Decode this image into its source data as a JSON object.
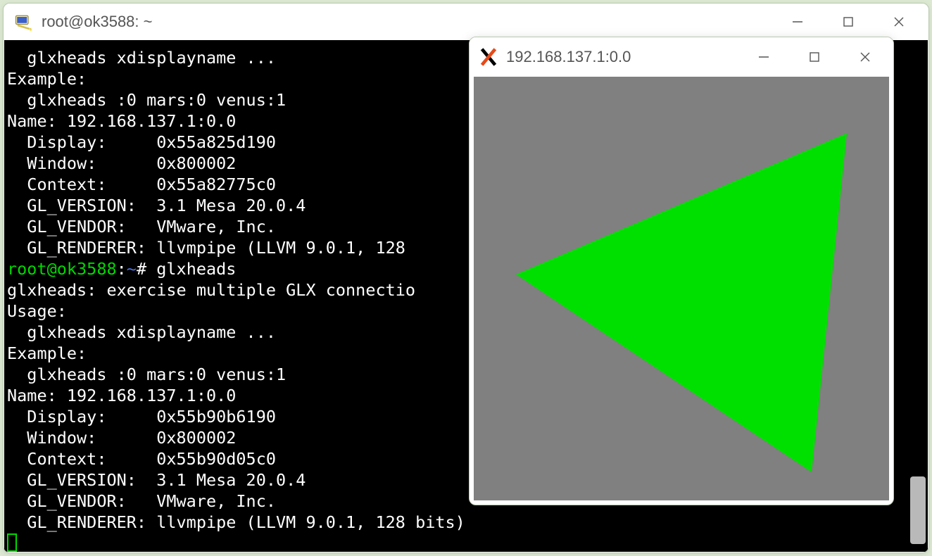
{
  "main_window": {
    "title": "root@ok3588: ~",
    "controls": {
      "minimize": "minimize",
      "maximize": "maximize",
      "close": "close"
    }
  },
  "x_window": {
    "title": "192.168.137.1:0.0",
    "controls": {
      "minimize": "minimize",
      "maximize": "maximize",
      "close": "close"
    },
    "render": {
      "background": "#808080",
      "triangle_color": "#00e000"
    }
  },
  "terminal": {
    "lines": [
      {
        "segs": [
          {
            "cls": "white",
            "t": "  glxheads xdisplayname ..."
          }
        ]
      },
      {
        "segs": [
          {
            "cls": "white",
            "t": "Example:"
          }
        ]
      },
      {
        "segs": [
          {
            "cls": "white",
            "t": "  glxheads :0 mars:0 venus:1"
          }
        ]
      },
      {
        "segs": [
          {
            "cls": "white",
            "t": "Name: 192.168.137.1:0.0"
          }
        ]
      },
      {
        "segs": [
          {
            "cls": "white",
            "t": "  Display:     0x55a825d190"
          }
        ]
      },
      {
        "segs": [
          {
            "cls": "white",
            "t": "  Window:      0x800002"
          }
        ]
      },
      {
        "segs": [
          {
            "cls": "white",
            "t": "  Context:     0x55a82775c0"
          }
        ]
      },
      {
        "segs": [
          {
            "cls": "white",
            "t": "  GL_VERSION:  3.1 Mesa 20.0.4"
          }
        ]
      },
      {
        "segs": [
          {
            "cls": "white",
            "t": "  GL_VENDOR:   VMware, Inc."
          }
        ]
      },
      {
        "segs": [
          {
            "cls": "white",
            "t": "  GL_RENDERER: llvmpipe (LLVM 9.0.1, 128 "
          }
        ]
      },
      {
        "segs": [
          {
            "cls": "green",
            "t": "root@ok3588"
          },
          {
            "cls": "white",
            "t": ":"
          },
          {
            "cls": "blue",
            "t": "~"
          },
          {
            "cls": "white",
            "t": "# glxheads"
          }
        ]
      },
      {
        "segs": [
          {
            "cls": "white",
            "t": "glxheads: exercise multiple GLX connectio"
          }
        ]
      },
      {
        "segs": [
          {
            "cls": "white",
            "t": "Usage:"
          }
        ]
      },
      {
        "segs": [
          {
            "cls": "white",
            "t": "  glxheads xdisplayname ..."
          }
        ]
      },
      {
        "segs": [
          {
            "cls": "white",
            "t": "Example:"
          }
        ]
      },
      {
        "segs": [
          {
            "cls": "white",
            "t": "  glxheads :0 mars:0 venus:1"
          }
        ]
      },
      {
        "segs": [
          {
            "cls": "white",
            "t": "Name: 192.168.137.1:0.0"
          }
        ]
      },
      {
        "segs": [
          {
            "cls": "white",
            "t": "  Display:     0x55b90b6190"
          }
        ]
      },
      {
        "segs": [
          {
            "cls": "white",
            "t": "  Window:      0x800002"
          }
        ]
      },
      {
        "segs": [
          {
            "cls": "white",
            "t": "  Context:     0x55b90d05c0"
          }
        ]
      },
      {
        "segs": [
          {
            "cls": "white",
            "t": "  GL_VERSION:  3.1 Mesa 20.0.4"
          }
        ]
      },
      {
        "segs": [
          {
            "cls": "white",
            "t": "  GL_VENDOR:   VMware, Inc."
          }
        ]
      },
      {
        "segs": [
          {
            "cls": "white",
            "t": "  GL_RENDERER: llvmpipe (LLVM 9.0.1, 128 bits)"
          }
        ]
      }
    ]
  }
}
